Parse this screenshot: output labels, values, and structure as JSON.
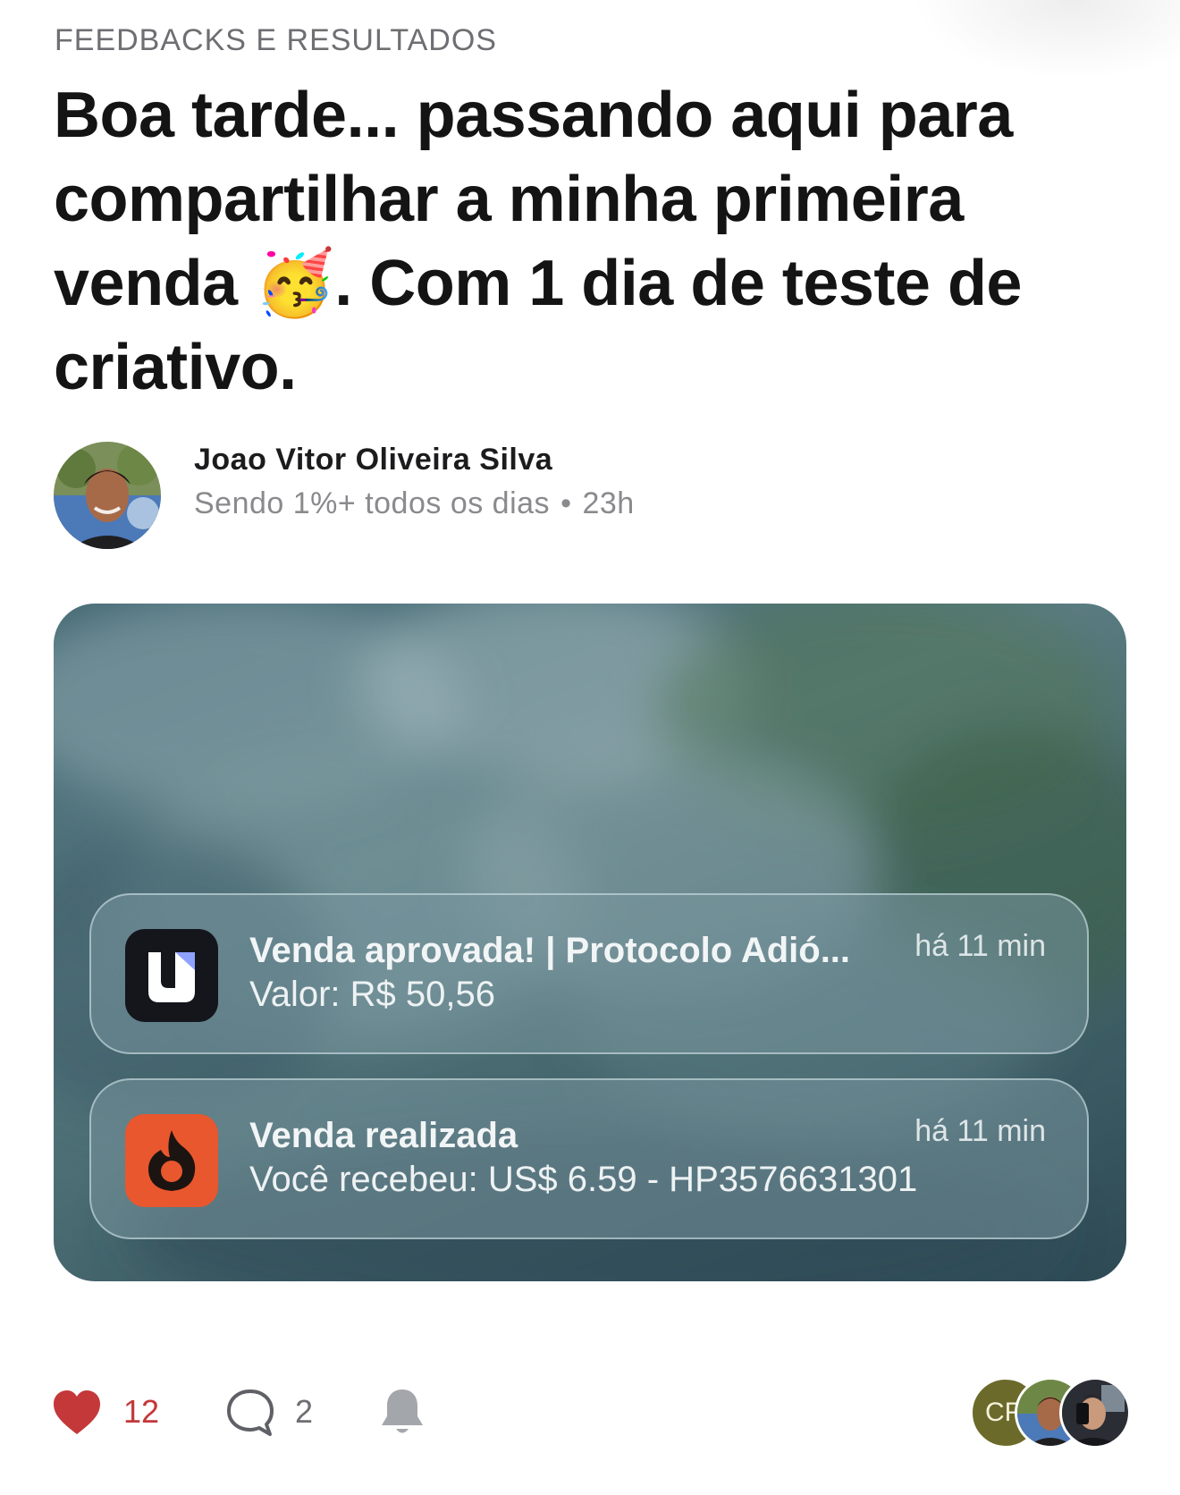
{
  "post": {
    "category": "FEEDBACKS E RESULTADOS",
    "title_part1": "Boa tarde... passando aqui para compartilhar a minha primeira venda ",
    "title_emoji": "🥳",
    "title_part2": ". Com 1 dia de teste de criativo."
  },
  "author": {
    "name": "Joao Vitor Oliveira Silva",
    "tagline": "Sendo 1%+ todos os dias",
    "separator": "•",
    "time": "23h"
  },
  "notifications": [
    {
      "app_icon": "utmify-icon",
      "title": "Venda aprovada! | Protocolo Adió...",
      "body": "Valor: R$ 50,56",
      "time": "há 11 min"
    },
    {
      "app_icon": "hotmart-flame-icon",
      "title": "Venda realizada",
      "body": "Você recebeu: US$ 6.59 - HP3576631301",
      "time": "há 11 min"
    }
  ],
  "footer": {
    "likes": "12",
    "comments": "2",
    "participants": [
      {
        "initials": "CF"
      },
      {
        "initials": ""
      },
      {
        "initials": ""
      }
    ]
  },
  "colors": {
    "like": "#c4383a",
    "muted": "#8a8a8e",
    "title": "#141414",
    "hotmart": "#e9572e",
    "utmify": "#14161c"
  }
}
